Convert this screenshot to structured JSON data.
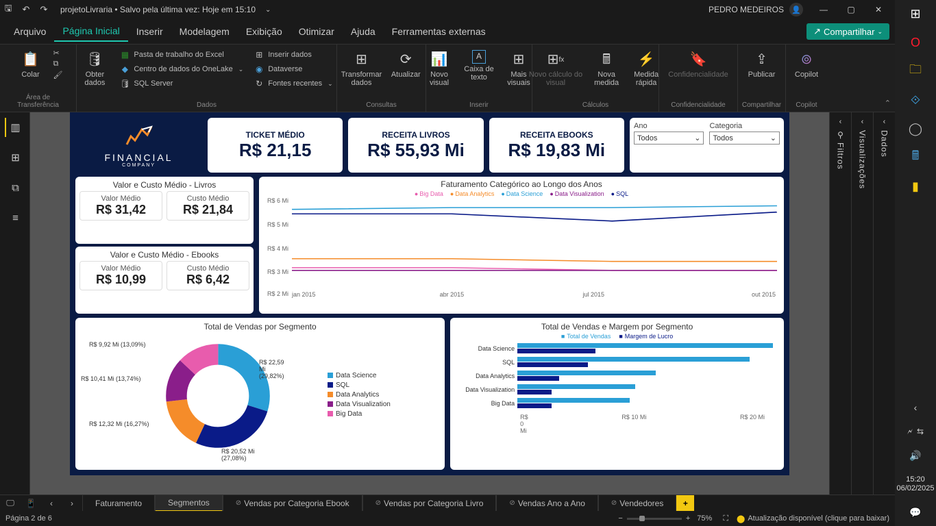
{
  "titlebar": {
    "title": "projetoLivraria • Salvo pela última vez: Hoje em 15:10",
    "user": "PEDRO MEDEIROS"
  },
  "menu": {
    "arquivo": "Arquivo",
    "pagina": "Página Inicial",
    "inserir": "Inserir",
    "modelagem": "Modelagem",
    "exibicao": "Exibição",
    "otimizar": "Otimizar",
    "ajuda": "Ajuda",
    "ferramentas": "Ferramentas externas",
    "compartilhar": "Compartilhar"
  },
  "ribbon": {
    "colar": "Colar",
    "area_transferencia": "Área de Transferência",
    "obter_dados": "Obter\ndados",
    "excel": "Pasta de trabalho do Excel",
    "onelake": "Centro de dados do OneLake",
    "sqlserver": "SQL Server",
    "inserir_dados": "Inserir dados",
    "dataverse": "Dataverse",
    "fontes_recentes": "Fontes recentes",
    "dados": "Dados",
    "transformar": "Transformar\ndados",
    "atualizar": "Atualizar",
    "consultas": "Consultas",
    "novo_visual": "Novo\nvisual",
    "caixa_texto": "Caixa de\ntexto",
    "mais_visuais": "Mais\nvisuais",
    "inserir_grp": "Inserir",
    "novo_calc": "Novo cálculo do\nvisual",
    "nova_medida": "Nova\nmedida",
    "medida_rapida": "Medida\nrápida",
    "calculos": "Cálculos",
    "confidencialidade": "Confidencialidade",
    "confidencialidade_grp": "Confidencialidade",
    "publicar": "Publicar",
    "compartilhar_grp": "Compartilhar",
    "copilot": "Copilot",
    "copilot_grp": "Copilot"
  },
  "panes": {
    "filtros": "Filtros",
    "visualizacoes": "Visualizações",
    "dados": "Dados"
  },
  "report": {
    "logo_name": "FINANCIAL",
    "logo_sub": "COMPANY",
    "kpi1_label": "TICKET MÉDIO",
    "kpi1_val": "R$ 21,15",
    "kpi2_label": "RECEITA LIVROS",
    "kpi2_val": "R$ 55,93 Mi",
    "kpi3_label": "RECEITA EBOOKS",
    "kpi3_val": "R$ 19,83 Mi",
    "slicer1_label": "Ano",
    "slicer1_val": "Todos",
    "slicer2_label": "Categoria",
    "slicer2_val": "Todos",
    "cg1_title": "Valor e Custo Médio - Livros",
    "cg1a_label": "Valor Médio",
    "cg1a_val": "R$ 31,42",
    "cg1b_label": "Custo Médio",
    "cg1b_val": "R$ 21,84",
    "cg2_title": "Valor e Custo Médio - Ebooks",
    "cg2a_label": "Valor Médio",
    "cg2a_val": "R$ 10,99",
    "cg2b_label": "Custo Médio",
    "cg2b_val": "R$ 6,42",
    "line_title": "Faturamento Categórico ao Longo dos Anos",
    "leg_bigdata": "Big Data",
    "leg_dataanalytics": "Data Analytics",
    "leg_datascience": "Data Science",
    "leg_dataviz": "Data Visualization",
    "leg_sql": "SQL",
    "y6": "R$ 6 Mi",
    "y5": "R$ 5 Mi",
    "y4": "R$ 4 Mi",
    "y3": "R$ 3 Mi",
    "y2": "R$ 2 Mi",
    "x1": "jan 2015",
    "x2": "abr 2015",
    "x3": "jul 2015",
    "x4": "out 2015",
    "donut_title": "Total de Vendas por Segmento",
    "dl1": "R$ 9,92 Mi (13,09%)",
    "dl2": "R$ 10,41 Mi (13,74%)",
    "dl3": "R$ 12,32 Mi (16,27%)",
    "dl4": "R$ 20,52 Mi (27,08%)",
    "dl5": "R$ 22,59 Mi (29,82%)",
    "bar_title": "Total de Vendas e Margem por Segmento",
    "bar_leg1": "Total de Vendas",
    "bar_leg2": "Margem de Lucro",
    "bcat_ds": "Data Science",
    "bcat_sql": "SQL",
    "bcat_da": "Data Analytics",
    "bcat_dv": "Data Visualization",
    "bcat_bd": "Big Data",
    "bx0": "R$ 0 Mi",
    "bx10": "R$ 10 Mi",
    "bx20": "R$ 20 Mi"
  },
  "chart_data": {
    "line": {
      "type": "line",
      "title": "Faturamento Categórico ao Longo dos Anos",
      "x": [
        "jan 2015",
        "abr 2015",
        "jul 2015",
        "out 2015"
      ],
      "ylim": [
        2,
        6
      ],
      "series": [
        {
          "name": "Big Data",
          "values": [
            2.9,
            2.9,
            2.8,
            2.8
          ],
          "color": "#e85cad"
        },
        {
          "name": "Data Analytics",
          "values": [
            3.3,
            3.3,
            3.2,
            3.2
          ],
          "color": "#f58c2a"
        },
        {
          "name": "Data Science",
          "values": [
            5.5,
            5.6,
            5.6,
            5.7
          ],
          "color": "#2a9fd6"
        },
        {
          "name": "Data Visualization",
          "values": [
            2.8,
            2.8,
            2.8,
            2.8
          ],
          "color": "#8a1e8a"
        },
        {
          "name": "SQL",
          "values": [
            5.3,
            5.3,
            5.0,
            5.4
          ],
          "color": "#0a1b88"
        }
      ]
    },
    "donut": {
      "type": "pie",
      "title": "Total de Vendas por Segmento",
      "categories": [
        "Data Science",
        "SQL",
        "Data Analytics",
        "Data Visualization",
        "Big Data"
      ],
      "values": [
        22.59,
        20.52,
        12.32,
        10.41,
        9.92
      ],
      "percents": [
        29.82,
        27.08,
        16.27,
        13.74,
        13.09
      ],
      "colors": [
        "#2a9fd6",
        "#0a1b88",
        "#f58c2a",
        "#8a1e8a",
        "#e85cad"
      ]
    },
    "bars": {
      "type": "bar",
      "title": "Total de Vendas e Margem por Segmento",
      "categories": [
        "Data Science",
        "SQL",
        "Data Analytics",
        "Data Visualization",
        "Big Data"
      ],
      "series": [
        {
          "name": "Total de Vendas",
          "values": [
            22.6,
            20.5,
            12.3,
            10.4,
            9.9
          ],
          "color": "#2a9fd6"
        },
        {
          "name": "Margem de Lucro",
          "values": [
            6.8,
            6.2,
            3.7,
            3.1,
            3.0
          ],
          "color": "#0a1b88"
        }
      ],
      "xlim": [
        0,
        23
      ]
    }
  },
  "tabs": {
    "t1": "Faturamento",
    "t2": "Segmentos",
    "t3": "Vendas por Categoria Ebook",
    "t4": "Vendas por Categoria Livro",
    "t5": "Vendas Ano a Ano",
    "t6": "Vendedores"
  },
  "status": {
    "page": "Página 2 de 6",
    "zoom": "75%",
    "update": "Atualização disponível (clique para baixar)"
  },
  "clock": {
    "time": "15:20",
    "date": "06/02/2025"
  }
}
